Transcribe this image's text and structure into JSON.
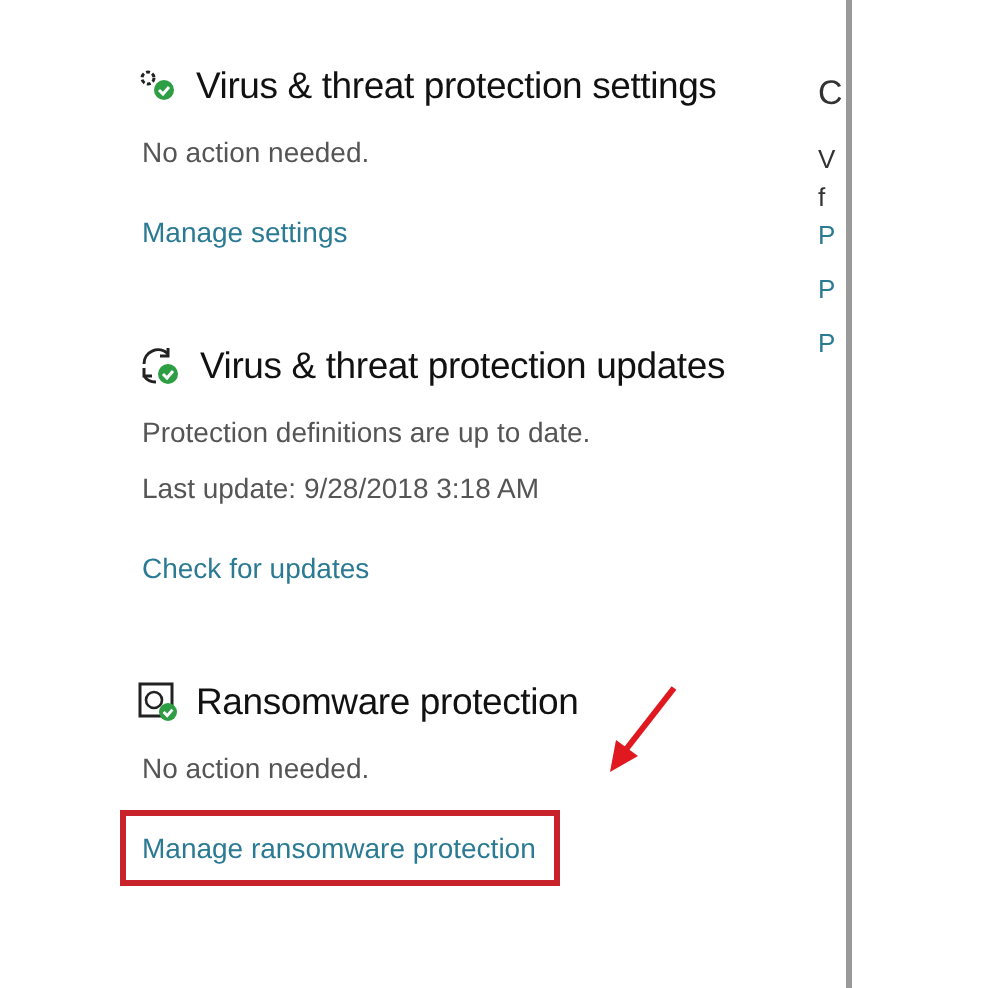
{
  "sections": [
    {
      "title": "Virus & threat protection settings",
      "lines": [
        "No action needed."
      ],
      "link": {
        "label": "Manage settings",
        "highlighted": false
      }
    },
    {
      "title": "Virus & threat protection updates",
      "lines": [
        "Protection definitions are up to date.",
        "Last update: 9/28/2018 3:18 AM"
      ],
      "link": {
        "label": "Check for updates",
        "highlighted": false
      }
    },
    {
      "title": "Ransomware protection",
      "lines": [
        "No action needed."
      ],
      "link": {
        "label": "Manage ransomware protection",
        "highlighted": true
      }
    }
  ],
  "side_column": [
    {
      "kind": "heading",
      "text": "C"
    },
    {
      "kind": "text",
      "text": "V"
    },
    {
      "kind": "text",
      "text": "f"
    },
    {
      "kind": "link",
      "text": "P"
    },
    {
      "kind": "link",
      "text": "P"
    },
    {
      "kind": "link",
      "text": "P"
    }
  ]
}
